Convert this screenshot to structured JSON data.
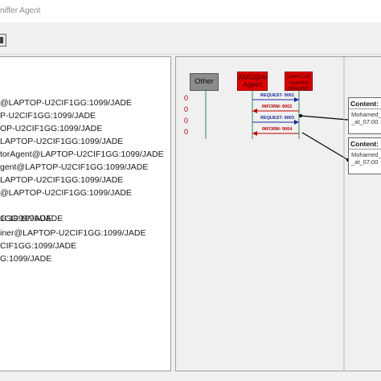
{
  "window": {
    "title": "niffer Agent"
  },
  "tree": {
    "items": [
      "@LAPTOP-U2CIF1GG:1099/JADE",
      "P-U2CIF1GG:1099/JADE",
      "OP-U2CIF1GG:1099/JADE",
      "LAPTOP-U2CIF1GG:1099/JADE",
      "torAgent@LAPTOP-U2CIF1GG:1099/JADE",
      "gent@LAPTOP-U2CIF1GG:1099/JADE",
      "LAPTOP-U2CIF1GG:1099/JADE",
      "@LAPTOP-U2CIF1GG:1099/JADE",
      "G:1099/JADE",
      "1GG:1099/JADE",
      "iner@LAPTOP-U2CIF1GG:1099/JADE",
      "CIF1GG:1099/JADE",
      "G:1099/JADE"
    ]
  },
  "sniffer": {
    "agents": {
      "other": "Other",
      "ams": "AMS@ACR Agent",
      "uc": "UserCult UserAs ollAgent"
    },
    "counters": [
      "0",
      "0",
      "0",
      "0"
    ],
    "messages": [
      {
        "label": "REQUEST- 9001",
        "color": "#1a2aa0",
        "direction": "right"
      },
      {
        "label": "INFORM- 9002",
        "color": "#c00000",
        "direction": "left"
      },
      {
        "label": "REQUEST- 9003",
        "color": "#1a2aa0",
        "direction": "right"
      },
      {
        "label": "INFORM- 9004",
        "color": "#c00000",
        "direction": "left"
      }
    ],
    "content_panels": [
      {
        "title": "Content:",
        "line1": "Mohamed_",
        "line2": "_at_07:00"
      },
      {
        "title": "Content:",
        "line1": "Mohamed_",
        "line2": "_at_07:00"
      }
    ]
  }
}
